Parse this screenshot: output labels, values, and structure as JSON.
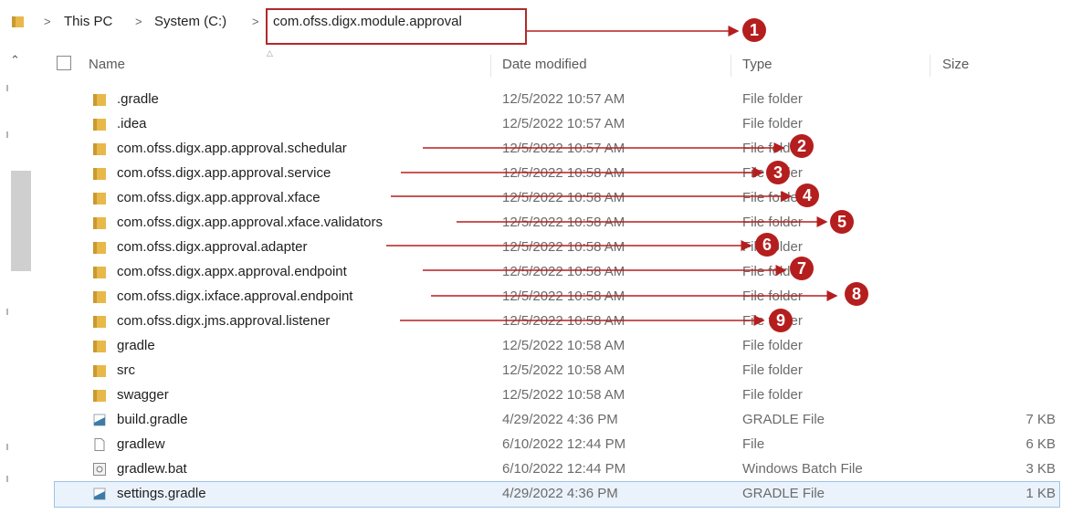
{
  "breadcrumb": {
    "items": [
      "This PC",
      "System (C:)",
      "com.ofss.digx.module.approval"
    ]
  },
  "columns": {
    "name": "Name",
    "date": "Date modified",
    "type": "Type",
    "size": "Size"
  },
  "files": [
    {
      "name": ".gradle",
      "date": "12/5/2022 10:57 AM",
      "type": "File folder",
      "size": "",
      "icon": "folder-icon"
    },
    {
      "name": ".idea",
      "date": "12/5/2022 10:57 AM",
      "type": "File folder",
      "size": "",
      "icon": "folder-icon"
    },
    {
      "name": "com.ofss.digx.app.approval.schedular",
      "date": "12/5/2022 10:57 AM",
      "type": "File folder",
      "size": "",
      "icon": "folder-icon"
    },
    {
      "name": "com.ofss.digx.app.approval.service",
      "date": "12/5/2022 10:58 AM",
      "type": "File folder",
      "size": "",
      "icon": "folder-icon"
    },
    {
      "name": "com.ofss.digx.app.approval.xface",
      "date": "12/5/2022 10:58 AM",
      "type": "File folder",
      "size": "",
      "icon": "folder-icon"
    },
    {
      "name": "com.ofss.digx.app.approval.xface.validators",
      "date": "12/5/2022 10:58 AM",
      "type": "File folder",
      "size": "",
      "icon": "folder-icon"
    },
    {
      "name": "com.ofss.digx.approval.adapter",
      "date": "12/5/2022 10:58 AM",
      "type": "File folder",
      "size": "",
      "icon": "folder-icon"
    },
    {
      "name": "com.ofss.digx.appx.approval.endpoint",
      "date": "12/5/2022 10:58 AM",
      "type": "File folder",
      "size": "",
      "icon": "folder-icon"
    },
    {
      "name": "com.ofss.digx.ixface.approval.endpoint",
      "date": "12/5/2022 10:58 AM",
      "type": "File folder",
      "size": "",
      "icon": "folder-icon"
    },
    {
      "name": "com.ofss.digx.jms.approval.listener",
      "date": "12/5/2022 10:58 AM",
      "type": "File folder",
      "size": "",
      "icon": "folder-icon"
    },
    {
      "name": "gradle",
      "date": "12/5/2022 10:58 AM",
      "type": "File folder",
      "size": "",
      "icon": "folder-icon"
    },
    {
      "name": "src",
      "date": "12/5/2022 10:58 AM",
      "type": "File folder",
      "size": "",
      "icon": "folder-icon"
    },
    {
      "name": "swagger",
      "date": "12/5/2022 10:58 AM",
      "type": "File folder",
      "size": "",
      "icon": "folder-icon"
    },
    {
      "name": "build.gradle",
      "date": "4/29/2022 4:36 PM",
      "type": "GRADLE File",
      "size": "7 KB",
      "icon": "gradle-file-icon"
    },
    {
      "name": "gradlew",
      "date": "6/10/2022 12:44 PM",
      "type": "File",
      "size": "6 KB",
      "icon": "blank-file-icon"
    },
    {
      "name": "gradlew.bat",
      "date": "6/10/2022 12:44 PM",
      "type": "Windows Batch File",
      "size": "3 KB",
      "icon": "batch-file-icon"
    },
    {
      "name": "settings.gradle",
      "date": "4/29/2022 4:36 PM",
      "type": "GRADLE File",
      "size": "1 KB",
      "icon": "gradle-file-icon"
    }
  ],
  "selected_row": 16,
  "annotations": [
    {
      "number": "1",
      "target": "breadcrumb"
    },
    {
      "number": "2",
      "target_row": 2
    },
    {
      "number": "3",
      "target_row": 3
    },
    {
      "number": "4",
      "target_row": 4
    },
    {
      "number": "5",
      "target_row": 5
    },
    {
      "number": "6",
      "target_row": 6
    },
    {
      "number": "7",
      "target_row": 7
    },
    {
      "number": "8",
      "target_row": 8
    },
    {
      "number": "9",
      "target_row": 9
    }
  ],
  "colors": {
    "annotation": "#b51e1e",
    "folder": "#e8b84a",
    "selection": "#eaf2fb"
  }
}
